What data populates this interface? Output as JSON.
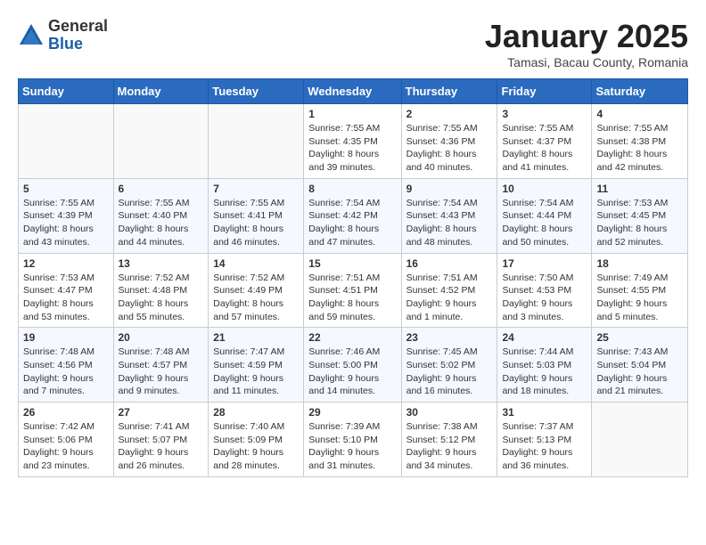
{
  "header": {
    "logo_general": "General",
    "logo_blue": "Blue",
    "month_title": "January 2025",
    "location": "Tamasi, Bacau County, Romania"
  },
  "days_of_week": [
    "Sunday",
    "Monday",
    "Tuesday",
    "Wednesday",
    "Thursday",
    "Friday",
    "Saturday"
  ],
  "weeks": [
    [
      {
        "day": "",
        "info": ""
      },
      {
        "day": "",
        "info": ""
      },
      {
        "day": "",
        "info": ""
      },
      {
        "day": "1",
        "info": "Sunrise: 7:55 AM\nSunset: 4:35 PM\nDaylight: 8 hours\nand 39 minutes."
      },
      {
        "day": "2",
        "info": "Sunrise: 7:55 AM\nSunset: 4:36 PM\nDaylight: 8 hours\nand 40 minutes."
      },
      {
        "day": "3",
        "info": "Sunrise: 7:55 AM\nSunset: 4:37 PM\nDaylight: 8 hours\nand 41 minutes."
      },
      {
        "day": "4",
        "info": "Sunrise: 7:55 AM\nSunset: 4:38 PM\nDaylight: 8 hours\nand 42 minutes."
      }
    ],
    [
      {
        "day": "5",
        "info": "Sunrise: 7:55 AM\nSunset: 4:39 PM\nDaylight: 8 hours\nand 43 minutes."
      },
      {
        "day": "6",
        "info": "Sunrise: 7:55 AM\nSunset: 4:40 PM\nDaylight: 8 hours\nand 44 minutes."
      },
      {
        "day": "7",
        "info": "Sunrise: 7:55 AM\nSunset: 4:41 PM\nDaylight: 8 hours\nand 46 minutes."
      },
      {
        "day": "8",
        "info": "Sunrise: 7:54 AM\nSunset: 4:42 PM\nDaylight: 8 hours\nand 47 minutes."
      },
      {
        "day": "9",
        "info": "Sunrise: 7:54 AM\nSunset: 4:43 PM\nDaylight: 8 hours\nand 48 minutes."
      },
      {
        "day": "10",
        "info": "Sunrise: 7:54 AM\nSunset: 4:44 PM\nDaylight: 8 hours\nand 50 minutes."
      },
      {
        "day": "11",
        "info": "Sunrise: 7:53 AM\nSunset: 4:45 PM\nDaylight: 8 hours\nand 52 minutes."
      }
    ],
    [
      {
        "day": "12",
        "info": "Sunrise: 7:53 AM\nSunset: 4:47 PM\nDaylight: 8 hours\nand 53 minutes."
      },
      {
        "day": "13",
        "info": "Sunrise: 7:52 AM\nSunset: 4:48 PM\nDaylight: 8 hours\nand 55 minutes."
      },
      {
        "day": "14",
        "info": "Sunrise: 7:52 AM\nSunset: 4:49 PM\nDaylight: 8 hours\nand 57 minutes."
      },
      {
        "day": "15",
        "info": "Sunrise: 7:51 AM\nSunset: 4:51 PM\nDaylight: 8 hours\nand 59 minutes."
      },
      {
        "day": "16",
        "info": "Sunrise: 7:51 AM\nSunset: 4:52 PM\nDaylight: 9 hours\nand 1 minute."
      },
      {
        "day": "17",
        "info": "Sunrise: 7:50 AM\nSunset: 4:53 PM\nDaylight: 9 hours\nand 3 minutes."
      },
      {
        "day": "18",
        "info": "Sunrise: 7:49 AM\nSunset: 4:55 PM\nDaylight: 9 hours\nand 5 minutes."
      }
    ],
    [
      {
        "day": "19",
        "info": "Sunrise: 7:48 AM\nSunset: 4:56 PM\nDaylight: 9 hours\nand 7 minutes."
      },
      {
        "day": "20",
        "info": "Sunrise: 7:48 AM\nSunset: 4:57 PM\nDaylight: 9 hours\nand 9 minutes."
      },
      {
        "day": "21",
        "info": "Sunrise: 7:47 AM\nSunset: 4:59 PM\nDaylight: 9 hours\nand 11 minutes."
      },
      {
        "day": "22",
        "info": "Sunrise: 7:46 AM\nSunset: 5:00 PM\nDaylight: 9 hours\nand 14 minutes."
      },
      {
        "day": "23",
        "info": "Sunrise: 7:45 AM\nSunset: 5:02 PM\nDaylight: 9 hours\nand 16 minutes."
      },
      {
        "day": "24",
        "info": "Sunrise: 7:44 AM\nSunset: 5:03 PM\nDaylight: 9 hours\nand 18 minutes."
      },
      {
        "day": "25",
        "info": "Sunrise: 7:43 AM\nSunset: 5:04 PM\nDaylight: 9 hours\nand 21 minutes."
      }
    ],
    [
      {
        "day": "26",
        "info": "Sunrise: 7:42 AM\nSunset: 5:06 PM\nDaylight: 9 hours\nand 23 minutes."
      },
      {
        "day": "27",
        "info": "Sunrise: 7:41 AM\nSunset: 5:07 PM\nDaylight: 9 hours\nand 26 minutes."
      },
      {
        "day": "28",
        "info": "Sunrise: 7:40 AM\nSunset: 5:09 PM\nDaylight: 9 hours\nand 28 minutes."
      },
      {
        "day": "29",
        "info": "Sunrise: 7:39 AM\nSunset: 5:10 PM\nDaylight: 9 hours\nand 31 minutes."
      },
      {
        "day": "30",
        "info": "Sunrise: 7:38 AM\nSunset: 5:12 PM\nDaylight: 9 hours\nand 34 minutes."
      },
      {
        "day": "31",
        "info": "Sunrise: 7:37 AM\nSunset: 5:13 PM\nDaylight: 9 hours\nand 36 minutes."
      },
      {
        "day": "",
        "info": ""
      }
    ]
  ]
}
